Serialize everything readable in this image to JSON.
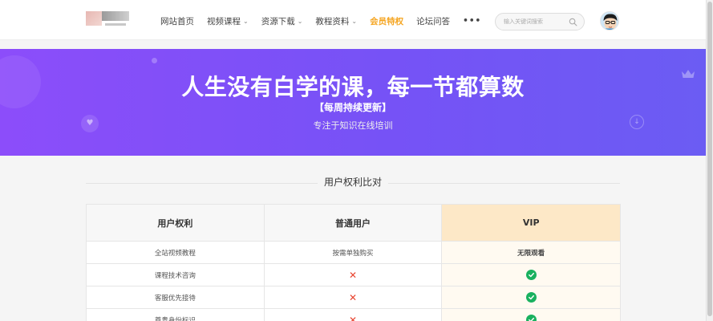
{
  "header": {
    "nav": [
      {
        "label": "网站首页",
        "caret": false,
        "vip": false
      },
      {
        "label": "视频课程",
        "caret": true,
        "vip": false
      },
      {
        "label": "资源下载",
        "caret": true,
        "vip": false
      },
      {
        "label": "教程资料",
        "caret": true,
        "vip": false
      },
      {
        "label": "会员特权",
        "caret": false,
        "vip": true
      },
      {
        "label": "论坛问答",
        "caret": false,
        "vip": false
      }
    ],
    "more_label": "•••",
    "caret_glyph": "⌄",
    "search_placeholder": "输入关键词搜索",
    "accent_vip_color": "#f5a623"
  },
  "banner": {
    "title": "人生没有白学的课，每一节都算数",
    "subtitle": "【每周持续更新】",
    "tagline": "专注于知识在线培训",
    "gradient_start": "#8c4dfa",
    "gradient_end": "#6b5cf3"
  },
  "section": {
    "title": "用户权利比对"
  },
  "table": {
    "headers": [
      "用户权利",
      "普通用户",
      "VIP"
    ],
    "rows": [
      {
        "right": "全站视频教程",
        "normal": {
          "type": "text",
          "text": "按需单独购买"
        },
        "vip": {
          "type": "text",
          "text": "无限观看"
        }
      },
      {
        "right": "课程技术咨询",
        "normal": {
          "type": "cross",
          "icon": "cross-icon"
        },
        "vip": {
          "type": "check",
          "icon": "check-icon"
        }
      },
      {
        "right": "客服优先接待",
        "normal": {
          "type": "cross",
          "icon": "cross-icon"
        },
        "vip": {
          "type": "check",
          "icon": "check-icon"
        }
      },
      {
        "right": "尊贵身份标识",
        "normal": {
          "type": "cross",
          "icon": "cross-icon"
        },
        "vip": {
          "type": "check",
          "icon": "check-icon"
        }
      }
    ],
    "cross_glyph": "✕",
    "cross_color": "#e8432e",
    "check_color": "#19b15f",
    "vip_header_color": "#fde8c7"
  }
}
